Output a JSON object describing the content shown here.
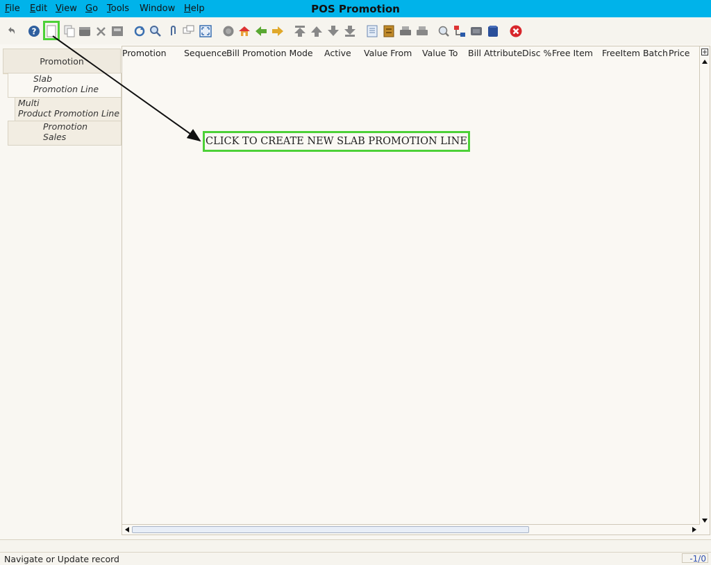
{
  "window": {
    "title": "POS Promotion"
  },
  "menu": [
    {
      "mnemonic": "F",
      "rest": "ile"
    },
    {
      "mnemonic": "E",
      "rest": "dit"
    },
    {
      "mnemonic": "V",
      "rest": "iew"
    },
    {
      "mnemonic": "G",
      "rest": "o"
    },
    {
      "mnemonic": "T",
      "rest": "ools"
    },
    {
      "mnemonic": "",
      "rest": "Window"
    },
    {
      "mnemonic": "H",
      "rest": "elp"
    }
  ],
  "toolbar_icons": [
    "undo-icon",
    "help-icon",
    "new-record-icon",
    "copy-record-icon",
    "delete-icon",
    "delete-selection-icon",
    "save-icon",
    "refresh-icon",
    "find-icon",
    "attachment-icon",
    "chat-icon",
    "grid-toggle-icon",
    "history-icon",
    "home-icon",
    "parent-record-icon",
    "detail-record-icon",
    "first-record-icon",
    "previous-record-icon",
    "next-record-icon",
    "last-record-icon",
    "report-icon",
    "archive-icon",
    "print-preview-icon",
    "print-icon",
    "zoom-across-icon",
    "workflow-icon",
    "product-info-icon",
    "close-window-icon",
    "end-icon"
  ],
  "tabs": {
    "promotion": "Promotion",
    "slab_line1": "Slab",
    "slab_line2": "Promotion Line",
    "multi_line1": "Multi",
    "multi_line2": "Product Promotion Line",
    "sales_line1": "Promotion",
    "sales_line2": "Sales"
  },
  "grid": {
    "columns": [
      "Promotion",
      "Sequence",
      "Bill Promotion Mode",
      "Active",
      "Value From",
      "Value To",
      "Bill Attribute",
      "Disc %",
      "Free Item",
      "FreeItem Batch",
      "Price"
    ]
  },
  "callout": {
    "text": "CLICK TO CREATE NEW SLAB PROMOTION LINE"
  },
  "status": {
    "message": "Navigate or Update record",
    "record_count": "-1/0"
  },
  "colors": {
    "menubar": "#00b3ea",
    "highlight": "#4cd137"
  }
}
